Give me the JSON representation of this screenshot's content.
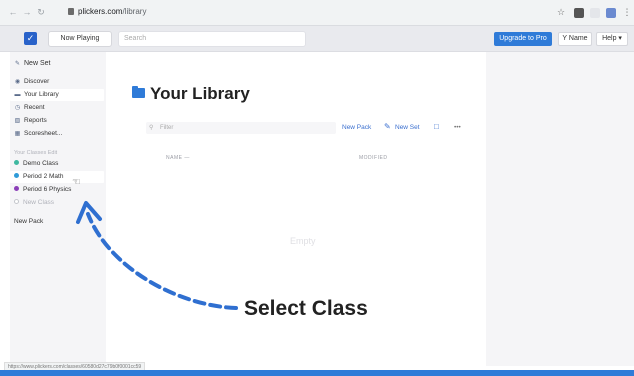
{
  "browser": {
    "url_host": "plickers.com",
    "url_path": "/library",
    "status_url": "https://www.plickers.com/classes/60580d27c79b0f0001cc59"
  },
  "topbar": {
    "now_playing": "Now Playing",
    "search_placeholder": "Search",
    "upgrade": "Upgrade to Pro",
    "name": "Y Name",
    "help": "Help"
  },
  "sidebar": {
    "new_set": "New Set",
    "nav": [
      {
        "label": "Discover",
        "icon": "compass-icon"
      },
      {
        "label": "Your Library",
        "icon": "folder-icon"
      },
      {
        "label": "Recent",
        "icon": "clock-icon"
      },
      {
        "label": "Reports",
        "icon": "report-icon"
      },
      {
        "label": "Scoresheet...",
        "icon": "grid-icon"
      }
    ],
    "classes_header": "Your Classes Edit",
    "classes": [
      {
        "label": "Demo Class",
        "color": "#3fb8a0"
      },
      {
        "label": "Period 2 Math",
        "color": "#2f9bd8"
      },
      {
        "label": "Period 6 Physics",
        "color": "#8b3fb8"
      }
    ],
    "new_class": "New Class",
    "new_pack": "New Pack"
  },
  "main": {
    "title": "Your Library",
    "filter_placeholder": "Filter",
    "new_pack": "New Pack",
    "new_set": "New Set",
    "more": "•••",
    "col_name": "NAME —",
    "col_modified": "MODIFIED",
    "empty": "Empty"
  },
  "annotation": {
    "label": "Select Class",
    "color": "#2f6fd0"
  }
}
